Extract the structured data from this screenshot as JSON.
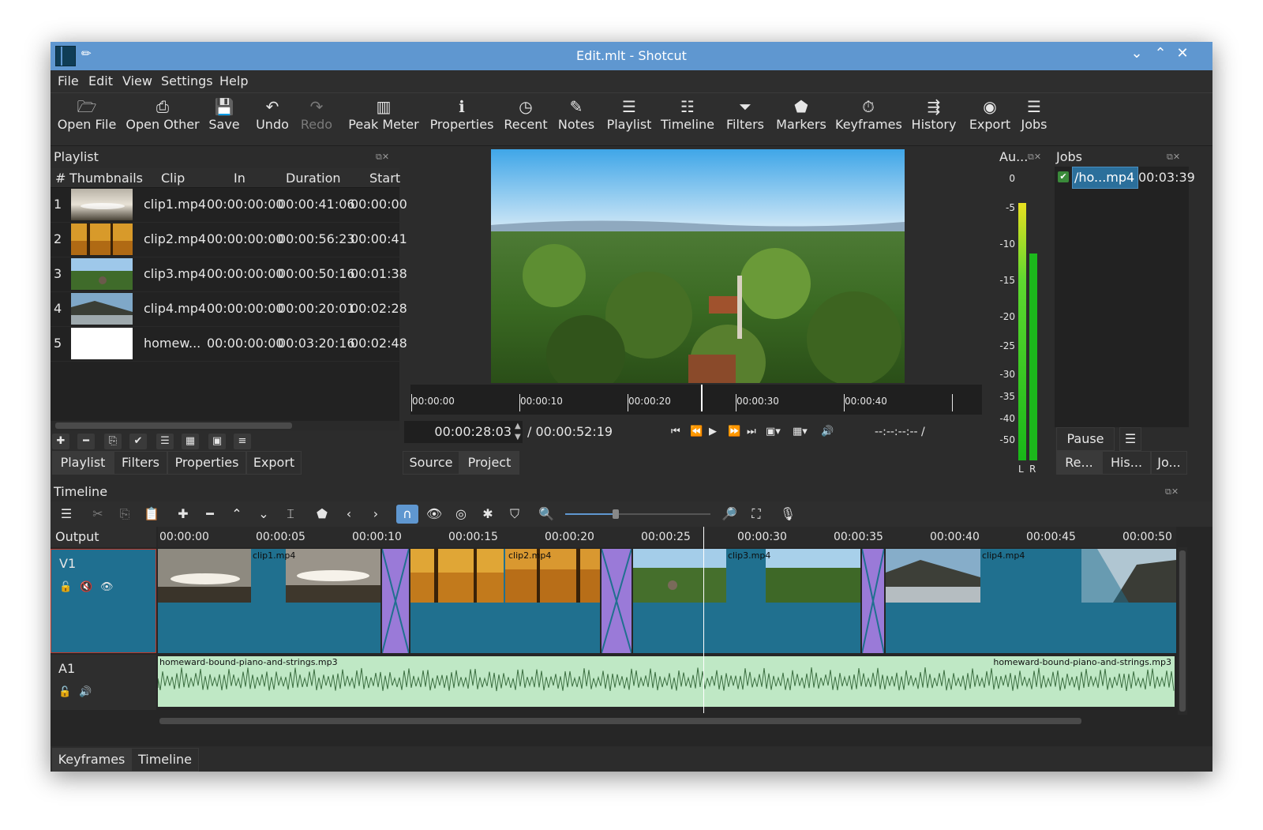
{
  "window": {
    "title": "Edit.mlt - Shotcut"
  },
  "menu": [
    "File",
    "Edit",
    "View",
    "Settings",
    "Help"
  ],
  "toolbar": [
    {
      "label": "Open File",
      "icon": "folder-open-icon",
      "glyph": "🗁"
    },
    {
      "label": "Open Other",
      "icon": "open-other-icon",
      "glyph": "⎙"
    },
    {
      "label": "Save",
      "icon": "floppy-icon",
      "glyph": "💾"
    },
    {
      "label": "Undo",
      "icon": "undo-icon",
      "glyph": "↶"
    },
    {
      "label": "Redo",
      "icon": "redo-icon",
      "glyph": "↷"
    },
    {
      "label": "Peak Meter",
      "icon": "peak-meter-icon",
      "glyph": "▥"
    },
    {
      "label": "Properties",
      "icon": "info-icon",
      "glyph": "ℹ"
    },
    {
      "label": "Recent",
      "icon": "clock-icon",
      "glyph": "◷"
    },
    {
      "label": "Notes",
      "icon": "notes-icon",
      "glyph": "✎"
    },
    {
      "label": "Playlist",
      "icon": "list-icon",
      "glyph": "☰"
    },
    {
      "label": "Timeline",
      "icon": "timeline-icon",
      "glyph": "☷"
    },
    {
      "label": "Filters",
      "icon": "funnel-icon",
      "glyph": "⏷"
    },
    {
      "label": "Markers",
      "icon": "marker-icon",
      "glyph": "⬟"
    },
    {
      "label": "Keyframes",
      "icon": "stopwatch-icon",
      "glyph": "⏱"
    },
    {
      "label": "History",
      "icon": "history-icon",
      "glyph": "⇶"
    },
    {
      "label": "Export",
      "icon": "disc-icon",
      "glyph": "◉"
    },
    {
      "label": "Jobs",
      "icon": "database-icon",
      "glyph": "☰"
    }
  ],
  "playlist": {
    "title": "Playlist",
    "columns": [
      "#",
      "Thumbnails",
      "Clip",
      "In",
      "Duration",
      "Start"
    ],
    "rows": [
      {
        "num": "1",
        "clip": "clip1.mp4",
        "in": "00:00:00:00",
        "duration": "00:00:41:06",
        "start": "00:00:00"
      },
      {
        "num": "2",
        "clip": "clip2.mp4",
        "in": "00:00:00:00",
        "duration": "00:00:56:23",
        "start": "00:00:41"
      },
      {
        "num": "3",
        "clip": "clip3.mp4",
        "in": "00:00:00:00",
        "duration": "00:00:50:16",
        "start": "00:01:38"
      },
      {
        "num": "4",
        "clip": "clip4.mp4",
        "in": "00:00:00:00",
        "duration": "00:00:20:01",
        "start": "00:02:28"
      },
      {
        "num": "5",
        "clip": "homew...",
        "in": "00:00:00:00",
        "duration": "00:03:20:16",
        "start": "00:02:48"
      }
    ],
    "tabs": [
      "Playlist",
      "Filters",
      "Properties",
      "Export"
    ]
  },
  "player": {
    "ruler_labels": [
      "00:00:00",
      "00:00:10",
      "00:00:20",
      "00:00:30",
      "00:00:40"
    ],
    "current_time": "00:00:28:03",
    "total_time": "/ 00:00:52:19",
    "in_out": "--:--:--:-- /",
    "tabs": [
      "Source",
      "Project"
    ],
    "progress": 0.536
  },
  "audio_meter": {
    "title": "Au...",
    "scale": [
      "0",
      "-5",
      "-10",
      "-15",
      "-20",
      "-25",
      "-30",
      "-35",
      "-40",
      "-50"
    ],
    "channels": [
      "L",
      "R"
    ]
  },
  "jobs": {
    "title": "Jobs",
    "items": [
      {
        "name": "/ho...mp4",
        "time": "00:03:39"
      }
    ],
    "pause_label": "Pause",
    "menu_glyph": "☰",
    "tabs": [
      "Re...",
      "His...",
      "Jo..."
    ]
  },
  "timeline": {
    "title": "Timeline",
    "output_label": "Output",
    "ruler_labels": [
      "00:00:00",
      "00:00:05",
      "00:00:10",
      "00:00:15",
      "00:00:20",
      "00:00:25",
      "00:00:30",
      "00:00:35",
      "00:00:40",
      "00:00:45",
      "00:00:50"
    ],
    "tracks": [
      {
        "name": "V1"
      },
      {
        "name": "A1"
      }
    ],
    "clips": [
      {
        "name": "clip1.mp4"
      },
      {
        "name": "clip2.mp4"
      },
      {
        "name": "clip3.mp4"
      },
      {
        "name": "clip4.mp4"
      }
    ],
    "audio_clip": "homeward-bound-piano-and-strings.mp3",
    "zoom": 0.35
  },
  "bottom_tabs": [
    "Keyframes",
    "Timeline"
  ],
  "colors": {
    "titlebar": "#5f97d0",
    "clip": "#20708f",
    "transition": "#9a7ad8",
    "audio": "#bfe8c5",
    "selection": "#2b6f9b"
  }
}
